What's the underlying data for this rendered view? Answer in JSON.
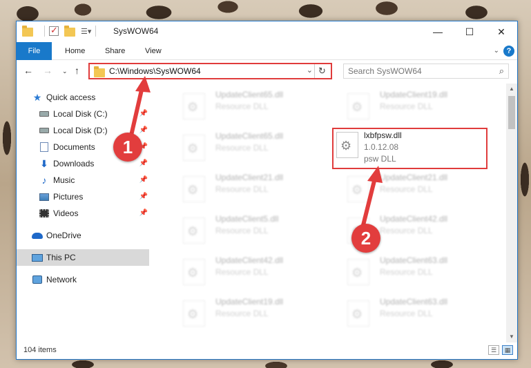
{
  "window": {
    "title": "SysWOW64"
  },
  "ribbon": {
    "tabs": [
      "File",
      "Home",
      "Share",
      "View"
    ],
    "help": "?"
  },
  "nav": {
    "path": "C:\\Windows\\SysWOW64",
    "search_placeholder": "Search SysWOW64"
  },
  "sidebar": {
    "items": [
      {
        "label": "Quick access",
        "icon": "star-icon",
        "pinned": false
      },
      {
        "label": "Local Disk (C:)",
        "icon": "drive-icon",
        "pinned": true
      },
      {
        "label": "Local Disk (D:)",
        "icon": "drive-icon",
        "pinned": true
      },
      {
        "label": "Documents",
        "icon": "documents-icon",
        "pinned": true
      },
      {
        "label": "Downloads",
        "icon": "download-icon",
        "pinned": true
      },
      {
        "label": "Music",
        "icon": "music-icon",
        "pinned": true
      },
      {
        "label": "Pictures",
        "icon": "pictures-icon",
        "pinned": true
      },
      {
        "label": "Videos",
        "icon": "videos-icon",
        "pinned": true
      },
      {
        "label": "OneDrive",
        "icon": "cloud-icon",
        "pinned": false
      },
      {
        "label": "This PC",
        "icon": "pc-icon",
        "pinned": false
      },
      {
        "label": "Network",
        "icon": "network-icon",
        "pinned": false
      }
    ]
  },
  "files": {
    "left": [
      {
        "name": "UpdateClient65.dll",
        "type": "Resource DLL"
      },
      {
        "name": "UpdateClient65.dll",
        "type": "Resource DLL"
      },
      {
        "name": "UpdateClient21.dll",
        "type": "Resource DLL"
      },
      {
        "name": "UpdateClient5.dll",
        "type": "Resource DLL"
      },
      {
        "name": "UpdateClient42.dll",
        "type": "Resource DLL"
      },
      {
        "name": "UpdateClient19.dll",
        "type": "Resource DLL"
      }
    ],
    "right": [
      {
        "name": "UpdateClient19.dll",
        "type": "Resource DLL"
      },
      {
        "name": "lxbfpsw.dll",
        "version": "1.0.12.08",
        "type": "psw DLL",
        "highlight": true
      },
      {
        "name": "UpdateClient21.dll",
        "type": "Resource DLL"
      },
      {
        "name": "UpdateClient42.dll",
        "type": "Resource DLL"
      },
      {
        "name": "UpdateClient63.dll",
        "type": "Resource DLL"
      },
      {
        "name": "UpdateClient63.dll",
        "type": "Resource DLL"
      }
    ]
  },
  "status": {
    "count": "104 items"
  },
  "annotations": {
    "badge1": "1",
    "badge2": "2",
    "color": "#e23d3d"
  }
}
